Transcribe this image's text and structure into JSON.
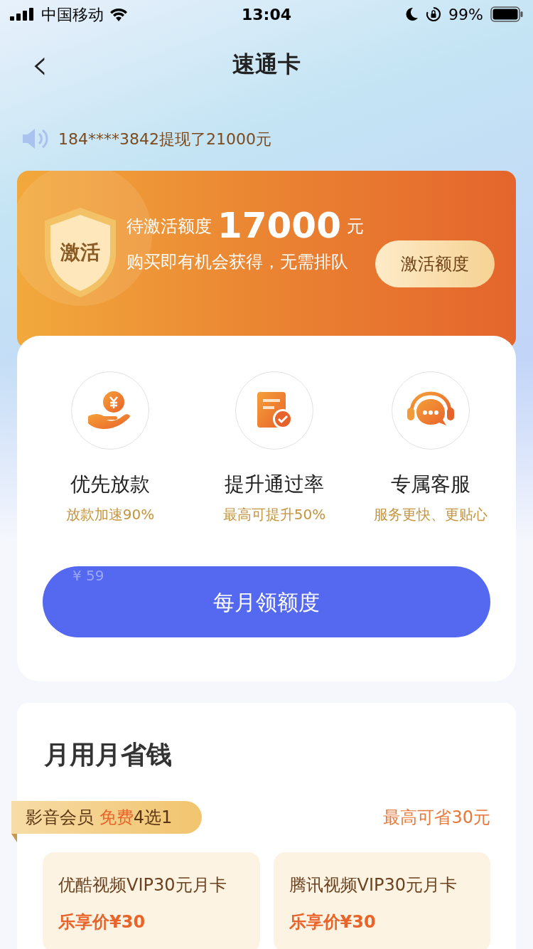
{
  "status_bar": {
    "carrier": "中国移动",
    "time": "13:04",
    "battery": "99%"
  },
  "nav": {
    "back": "‹",
    "title": "速通卡"
  },
  "ticker": "184****3842提现了21000元",
  "activate_card": {
    "badge": "激活",
    "label": "待激活额度",
    "amount": "17000",
    "unit": "元",
    "subtitle": "购买即有机会获得，无需排队",
    "button": "激活额度"
  },
  "features": [
    {
      "kind": "loan",
      "title": "优先放款",
      "subtitle": "放款加速90%"
    },
    {
      "kind": "approve",
      "title": "提升通过率",
      "subtitle": "最高可提升50%"
    },
    {
      "kind": "service",
      "title": "专属客服",
      "subtitle": "服务更快、更贴心"
    }
  ],
  "cta": {
    "price": "¥ 59",
    "label": "每月领额度"
  },
  "savings": {
    "title": "月用月省钱",
    "tag": {
      "label": "影音会员 ",
      "highlight": "免费",
      "suffix": "4选1"
    },
    "max_saving": "最高可省30元",
    "products": [
      {
        "title": "优酷视频VIP30元月卡",
        "price": "乐享价¥30"
      },
      {
        "title": "腾讯视频VIP30元月卡",
        "price": "乐享价¥30"
      }
    ]
  }
}
